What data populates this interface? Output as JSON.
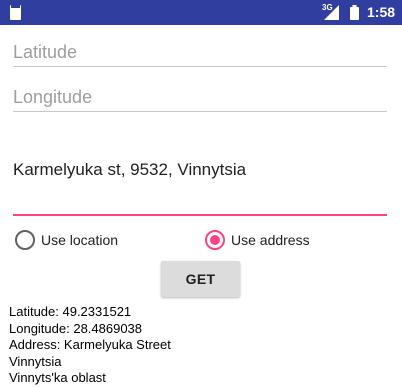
{
  "status_bar": {
    "network_label": "3G",
    "time": "1:58",
    "icons": [
      "sd-card-icon",
      "signal-icon",
      "battery-icon"
    ]
  },
  "form": {
    "latitude_placeholder": "Latitude",
    "longitude_placeholder": "Longitude",
    "address_value": "Karmelyuka st, 9532, Vinnytsia"
  },
  "mode": {
    "use_location_label": "Use location",
    "use_address_label": "Use address",
    "selected": "use_address"
  },
  "get_button_label": "GET",
  "result_lines": [
    "Latitude: 49.2331521",
    "Longitude: 28.4869038",
    "Address: Karmelyuka Street",
    "Vinnytsia",
    "Vinnyts'ka oblast"
  ],
  "colors": {
    "status_bar": "#303f9f",
    "accent": "#ff4081",
    "button": "#dcdcdc"
  }
}
